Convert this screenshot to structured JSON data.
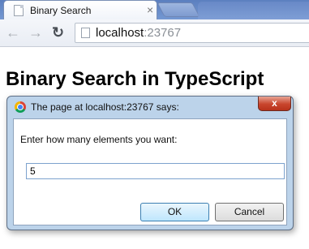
{
  "browser": {
    "tab_title": "Binary Search",
    "tab_close_glyph": "×",
    "url_host": "localhost",
    "url_port": ":23767",
    "back_glyph": "←",
    "forward_glyph": "→",
    "reload_glyph": "↻"
  },
  "page": {
    "heading": "Binary Search in TypeScript"
  },
  "dialog": {
    "title": "The page at localhost:23767 says:",
    "close_glyph": "x",
    "message": "Enter how many elements you want:",
    "input_value": "5",
    "ok_label": "OK",
    "cancel_label": "Cancel"
  },
  "icons": {
    "tab_favicon": "page-icon",
    "omnibox_icon": "page-icon",
    "dialog_icon": "chrome-icon"
  },
  "colors": {
    "tab_strip": "#5b7fbf",
    "dialog_frame": "#bcd3ea",
    "close_button": "#c8452d",
    "ok_button": "#bee6fd",
    "input_border": "#7da2ce"
  }
}
